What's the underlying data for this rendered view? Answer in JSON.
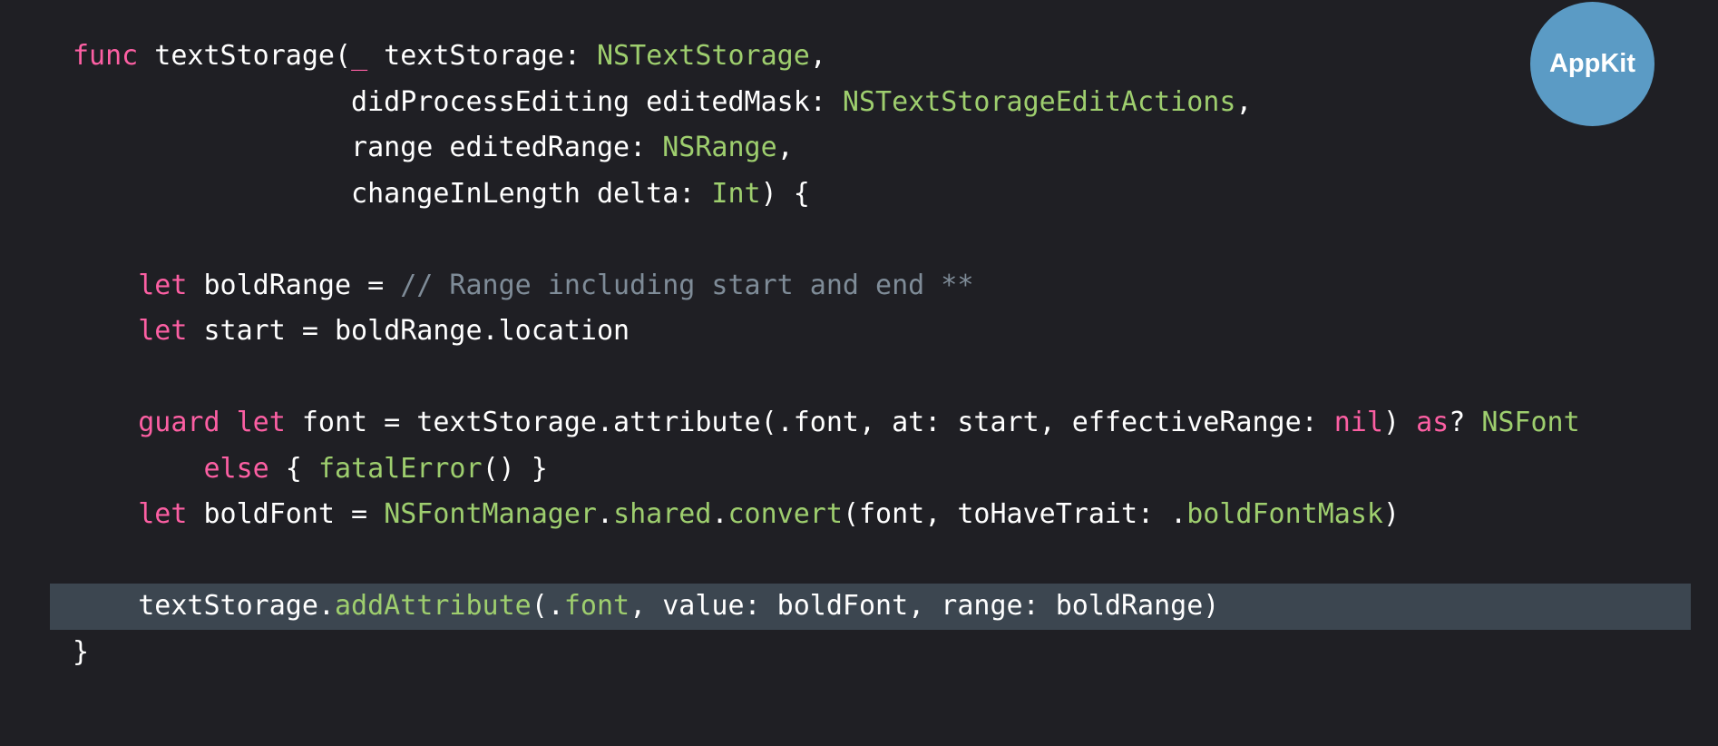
{
  "colors": {
    "background": "#1f1f24",
    "plain": "#ffffff",
    "keyword": "#fc5fa3",
    "type": "#9ece6e",
    "comment": "#7f8c98",
    "highlight_bg": "#3c4650",
    "badge_bg": "#5b9bc5"
  },
  "badge": {
    "label": "AppKit",
    "icon": "appkit-badge"
  },
  "code": {
    "highlighted_line": 13,
    "lines": [
      [
        {
          "t": "func",
          "k": "keyword"
        },
        {
          "t": " textStorage(",
          "k": "plain"
        },
        {
          "t": "_",
          "k": "keyword"
        },
        {
          "t": " textStorage: ",
          "k": "plain"
        },
        {
          "t": "NSTextStorage",
          "k": "type"
        },
        {
          "t": ",",
          "k": "plain"
        }
      ],
      [
        {
          "t": "                 didProcessEditing editedMask: ",
          "k": "plain"
        },
        {
          "t": "NSTextStorageEditActions",
          "k": "type"
        },
        {
          "t": ",",
          "k": "plain"
        }
      ],
      [
        {
          "t": "                 range editedRange: ",
          "k": "plain"
        },
        {
          "t": "NSRange",
          "k": "type"
        },
        {
          "t": ",",
          "k": "plain"
        }
      ],
      [
        {
          "t": "                 changeInLength delta: ",
          "k": "plain"
        },
        {
          "t": "Int",
          "k": "type"
        },
        {
          "t": ") {",
          "k": "plain"
        }
      ],
      [],
      [
        {
          "t": "    ",
          "k": "plain"
        },
        {
          "t": "let",
          "k": "keyword"
        },
        {
          "t": " boldRange = ",
          "k": "plain"
        },
        {
          "t": "// Range including start and end **",
          "k": "comment"
        }
      ],
      [
        {
          "t": "    ",
          "k": "plain"
        },
        {
          "t": "let",
          "k": "keyword"
        },
        {
          "t": " start = boldRange.location",
          "k": "plain"
        }
      ],
      [],
      [
        {
          "t": "    ",
          "k": "plain"
        },
        {
          "t": "guard",
          "k": "keyword"
        },
        {
          "t": " ",
          "k": "plain"
        },
        {
          "t": "let",
          "k": "keyword"
        },
        {
          "t": " font = textStorage.attribute(.font, at: start, effectiveRange: ",
          "k": "plain"
        },
        {
          "t": "nil",
          "k": "keyword"
        },
        {
          "t": ") ",
          "k": "plain"
        },
        {
          "t": "as",
          "k": "keyword"
        },
        {
          "t": "? ",
          "k": "plain"
        },
        {
          "t": "NSFont",
          "k": "type"
        }
      ],
      [
        {
          "t": "        ",
          "k": "plain"
        },
        {
          "t": "else",
          "k": "keyword"
        },
        {
          "t": " { ",
          "k": "plain"
        },
        {
          "t": "fatalError",
          "k": "type"
        },
        {
          "t": "() }",
          "k": "plain"
        }
      ],
      [
        {
          "t": "    ",
          "k": "plain"
        },
        {
          "t": "let",
          "k": "keyword"
        },
        {
          "t": " boldFont = ",
          "k": "plain"
        },
        {
          "t": "NSFontManager",
          "k": "type"
        },
        {
          "t": ".",
          "k": "plain"
        },
        {
          "t": "shared",
          "k": "type"
        },
        {
          "t": ".",
          "k": "plain"
        },
        {
          "t": "convert",
          "k": "type"
        },
        {
          "t": "(font, toHaveTrait: .",
          "k": "plain"
        },
        {
          "t": "boldFontMask",
          "k": "type"
        },
        {
          "t": ")",
          "k": "plain"
        }
      ],
      [],
      [
        {
          "t": "    textStorage.",
          "k": "plain"
        },
        {
          "t": "addAttribute",
          "k": "type"
        },
        {
          "t": "(.",
          "k": "plain"
        },
        {
          "t": "font",
          "k": "type"
        },
        {
          "t": ", value: boldFont, range: boldRange)",
          "k": "plain"
        }
      ],
      [
        {
          "t": "}",
          "k": "plain"
        }
      ]
    ]
  }
}
